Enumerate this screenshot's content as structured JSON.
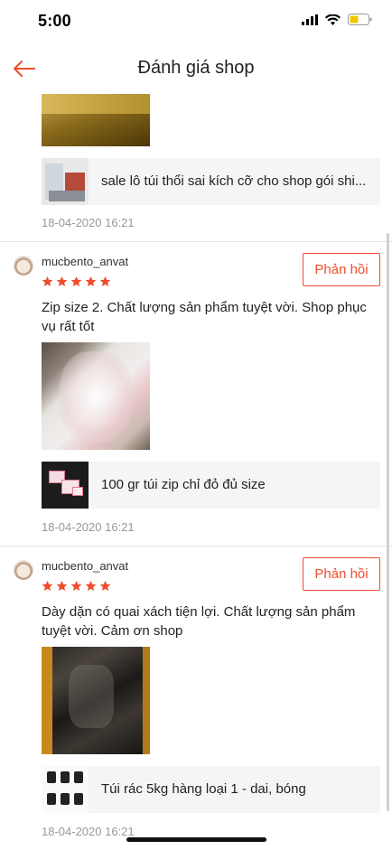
{
  "status_bar": {
    "time": "5:00",
    "battery_color": "#f5c400"
  },
  "header": {
    "title": "Đánh giá shop",
    "back_icon": "arrow-left-icon",
    "accent": "#ee4d2d"
  },
  "reviews": [
    {
      "product_name": "sale lô túi thổi sai kích cỡ cho shop gói shi...",
      "date": "18-04-2020 16:21"
    },
    {
      "username": "mucbento_anvat",
      "rating": 5,
      "reply_label": "Phản hồi",
      "text": "Zip size 2. Chất lượng sản phẩm tuyệt vời. Shop phục vụ rất tốt",
      "product_name": "100 gr túi zip chỉ đỏ đủ size",
      "date": "18-04-2020 16:21"
    },
    {
      "username": "mucbento_anvat",
      "rating": 5,
      "reply_label": "Phản hồi",
      "text": "Dày dặn có quai xách tiện lợi. Chất lượng sản phẩm tuyệt vời. Cảm ơn shop",
      "product_name": "Túi rác 5kg hàng loại 1 - dai, bóng",
      "date": "18-04-2020 16:21"
    }
  ]
}
